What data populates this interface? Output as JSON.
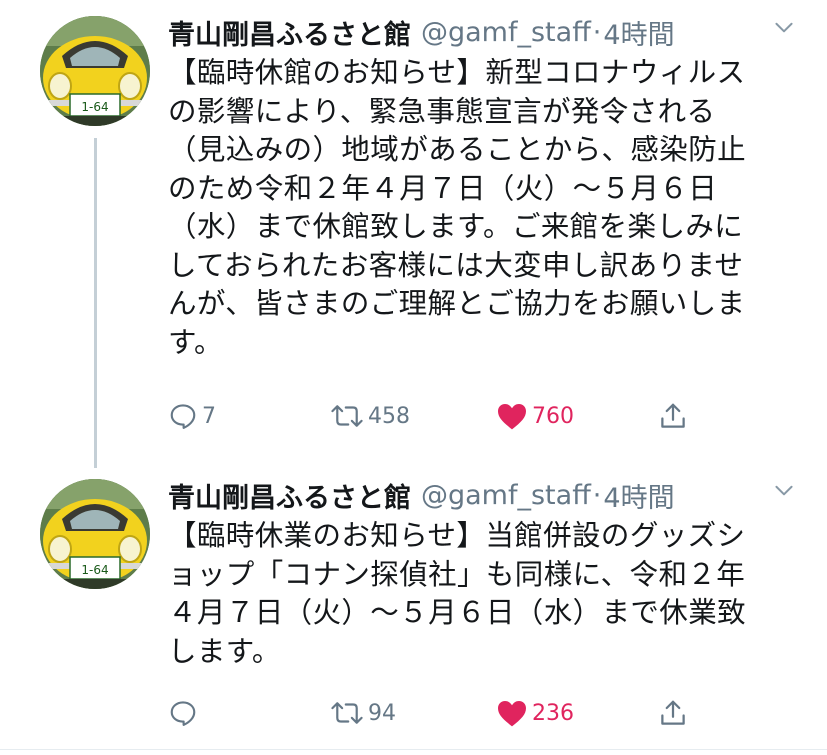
{
  "tweets": [
    {
      "author_name": "青山剛昌ふるさと館",
      "handle": "@gamf_staff",
      "separator": "·",
      "time": "4時間",
      "text_lines": [
        "【臨時休館のお知らせ】新型コロナウィルス",
        "の影響により、緊急事態宣言が発令される",
        "（見込みの）地域があることから、感染防止",
        "のため令和２年４月７日（火）～５月６日",
        "（水）まで休館致します。ご来館を楽しみに",
        "しておられたお客様には大変申し訳ありませ",
        "んが、皆さまのご理解とご協力をお願いしま",
        "す。"
      ],
      "reply_count": "7",
      "retweet_count": "458",
      "like_count": "760",
      "avatar_plate": "1-64"
    },
    {
      "author_name": "青山剛昌ふるさと館",
      "handle": "@gamf_staff",
      "separator": "·",
      "time": "4時間",
      "text_lines": [
        "【臨時休業のお知らせ】当館併設のグッズシ",
        "ョップ「コナン探偵社」も同様に、令和２年",
        "４月７日（火）～５月６日（水）まで休業致",
        "します。"
      ],
      "reply_count": "",
      "retweet_count": "94",
      "like_count": "236",
      "avatar_plate": "1-64"
    }
  ],
  "colors": {
    "text_primary": "#14171a",
    "text_secondary": "#657786",
    "like_red": "#e0245e",
    "thread_line": "#c4cfd6",
    "car_yellow": "#f2d21e"
  },
  "icons": {
    "reply": "reply-icon",
    "retweet": "retweet-icon",
    "like": "heart-icon",
    "share": "share-icon",
    "caret": "chevron-down-icon"
  }
}
